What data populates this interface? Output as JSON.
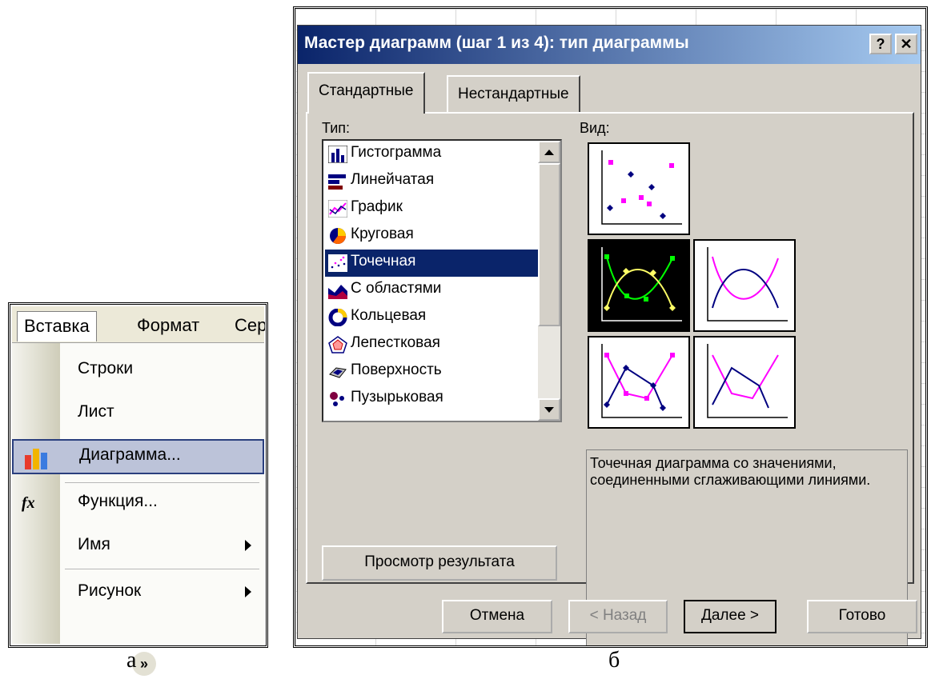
{
  "menu": {
    "bar": [
      "Вставка",
      "Формат",
      "Сер"
    ],
    "items": [
      {
        "label": "Строки",
        "icon": "none",
        "submenu": false
      },
      {
        "label": "Лист",
        "icon": "none",
        "submenu": false
      },
      {
        "label": "Диаграмма...",
        "icon": "bar-chart-icon",
        "submenu": false,
        "highlighted": true
      },
      {
        "label": "Функция...",
        "icon": "fx-icon",
        "submenu": false
      },
      {
        "label": "Имя",
        "icon": "none",
        "submenu": true
      },
      {
        "label": "Рисунок",
        "icon": "none",
        "submenu": true
      }
    ],
    "expand": "»"
  },
  "wizard": {
    "title": "Мастер диаграмм (шаг 1 из 4): тип диаграммы",
    "help": "?",
    "close": "✕",
    "tabs": [
      "Стандартные",
      "Нестандартные"
    ],
    "active_tab": "Стандартные",
    "type_label": "Тип:",
    "view_label": "Вид:",
    "types": [
      {
        "label": "Гистограмма",
        "icon": "column-chart-icon"
      },
      {
        "label": "Линейчатая",
        "icon": "bar-chart-icon"
      },
      {
        "label": "График",
        "icon": "line-chart-icon"
      },
      {
        "label": "Круговая",
        "icon": "pie-chart-icon"
      },
      {
        "label": "Точечная",
        "icon": "scatter-chart-icon",
        "selected": true
      },
      {
        "label": "С областями",
        "icon": "area-chart-icon"
      },
      {
        "label": "Кольцевая",
        "icon": "doughnut-chart-icon"
      },
      {
        "label": "Лепестковая",
        "icon": "radar-chart-icon"
      },
      {
        "label": "Поверхность",
        "icon": "surface-chart-icon"
      },
      {
        "label": "Пузырьковая",
        "icon": "bubble-chart-icon"
      }
    ],
    "selected_type": "Точечная",
    "subtypes_count": 5,
    "selected_subtype": 2,
    "description": "Точечная диаграмма со значениями, соединенными сглаживающими линиями.",
    "preview_button": "Просмотр результата",
    "buttons": {
      "cancel": "Отмена",
      "back": "< Назад",
      "next": "Далее >",
      "finish": "Готово"
    },
    "colors": {
      "title_start": "#0a246a",
      "title_end": "#a6caf0",
      "dialog": "#d4d0c8",
      "series_a": "#ff00ff",
      "series_b": "#000080",
      "selected_series_a": "#ffff66",
      "selected_series_b": "#00ff00"
    }
  },
  "captions": {
    "a": "а",
    "b": "б"
  }
}
